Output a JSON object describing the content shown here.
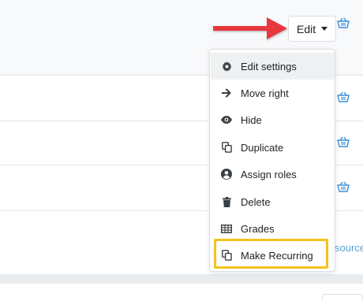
{
  "edit_button": {
    "label": "Edit"
  },
  "menu": {
    "items": [
      {
        "label": "Edit settings",
        "icon": "gear-icon"
      },
      {
        "label": "Move right",
        "icon": "arrow-right-icon"
      },
      {
        "label": "Hide",
        "icon": "eye-icon"
      },
      {
        "label": "Duplicate",
        "icon": "copy-icon"
      },
      {
        "label": "Assign roles",
        "icon": "user-icon"
      },
      {
        "label": "Delete",
        "icon": "trash-icon"
      },
      {
        "label": "Grades",
        "icon": "table-icon"
      },
      {
        "label": "Make Recurring",
        "icon": "copy-icon"
      }
    ]
  },
  "resource_link": {
    "label": "source"
  },
  "colors": {
    "arrow": "#e8393d",
    "highlight": "#f5c21b",
    "basket": "#3d8fd9",
    "link": "#5aa3d6"
  }
}
